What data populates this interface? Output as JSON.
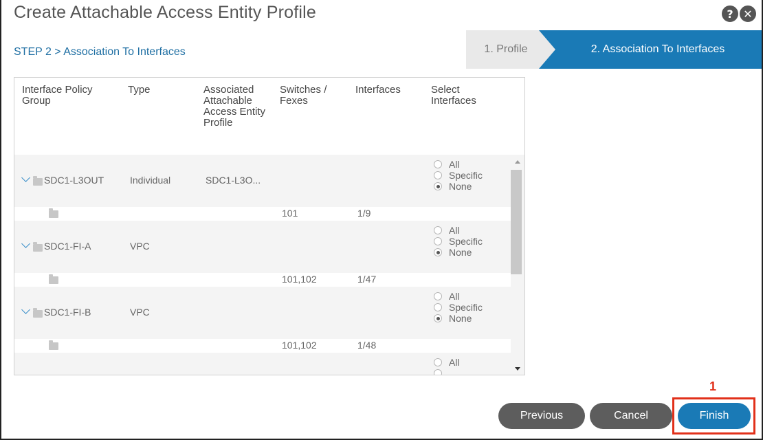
{
  "dialog": {
    "title": "Create Attachable Access Entity Profile",
    "help_icon": "help-icon",
    "close_icon": "close-icon",
    "step_label": "STEP 2 > Association To Interfaces"
  },
  "wizard": {
    "step1": "1. Profile",
    "step2": "2. Association To Interfaces"
  },
  "table": {
    "headers": {
      "policy_group": "Interface Policy Group",
      "type": "Type",
      "aaep": "Associated Attachable Access Entity Profile",
      "switches": "Switches / Fexes",
      "interfaces": "Interfaces",
      "select": "Select Interfaces"
    },
    "radio_labels": {
      "all": "All",
      "specific": "Specific",
      "none": "None"
    },
    "rows": [
      {
        "name": "SDC1-L3OUT",
        "type": "Individual",
        "aaep": "SDC1-L3O...",
        "switches": "101",
        "interfaces": "1/9",
        "selected": "None"
      },
      {
        "name": "SDC1-FI-A",
        "type": "VPC",
        "aaep": "",
        "switches": "101,102",
        "interfaces": "1/47",
        "selected": "None"
      },
      {
        "name": "SDC1-FI-B",
        "type": "VPC",
        "aaep": "",
        "switches": "101,102",
        "interfaces": "1/48",
        "selected": "None"
      }
    ]
  },
  "buttons": {
    "previous": "Previous",
    "cancel": "Cancel",
    "finish": "Finish"
  },
  "annotation": {
    "callout": "1"
  },
  "colors": {
    "accent": "#1a7ab6",
    "highlight": "#e1301a",
    "button_dark": "#5d5d5d"
  }
}
